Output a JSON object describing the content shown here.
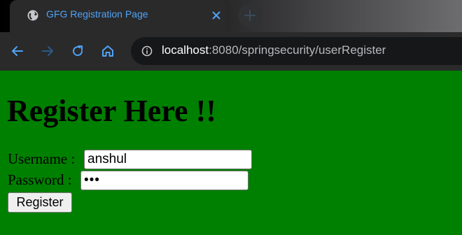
{
  "browser": {
    "tab": {
      "title": "GFG Registration Page"
    },
    "address_bar": {
      "host": "localhost",
      "path": ":8080/springsecurity/userRegister"
    },
    "colors": {
      "accent": "#4fa3f7",
      "chrome_bg": "#2a2a2b"
    }
  },
  "page": {
    "background": "#008000",
    "heading": "Register Here !!",
    "form": {
      "username_label": "Username :",
      "username_value": "anshul",
      "password_label": "Password :",
      "password_value": "•••",
      "submit_label": "Register"
    }
  }
}
